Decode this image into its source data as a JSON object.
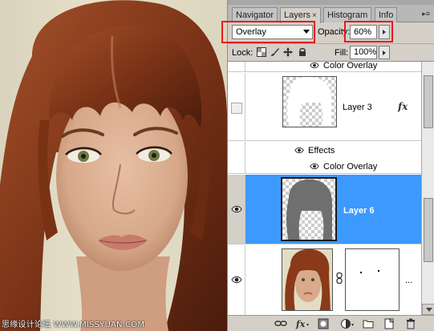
{
  "watermark": "思缘设计论坛  WWW.MISSYUAN.COM",
  "tabs": [
    {
      "label": "Navigator",
      "active": false
    },
    {
      "label": "Layers",
      "active": true
    },
    {
      "label": "Histogram",
      "active": false
    },
    {
      "label": "Info",
      "active": false
    }
  ],
  "tab_close_glyph": "×",
  "panel_menu_glyph": "▸≡",
  "blend_mode": "Overlay",
  "opacity": {
    "label": "Opacity:",
    "value": "60%"
  },
  "lock": {
    "label": "Lock:",
    "icons": [
      "transparent-pixels-icon",
      "brush-icon",
      "move-icon",
      "lock-icon"
    ]
  },
  "fill": {
    "label": "Fill:",
    "value": "100%"
  },
  "layers": {
    "partial_effect_top": "Color Overlay",
    "layer3": {
      "name": "Layer 3",
      "visible": false,
      "fx": "fx"
    },
    "layer3_effects_label": "Effects",
    "layer3_color_overlay": "Color Overlay",
    "layer6": {
      "name": "Layer 6",
      "selected": true,
      "visible": true
    },
    "photo_layer": {
      "visible": true,
      "more": "..."
    }
  },
  "bottom_icons": [
    "link-icon",
    "fx-icon",
    "mask-icon",
    "adjustment-icon",
    "folder-icon",
    "new-layer-icon",
    "trash-icon"
  ],
  "colors": {
    "selection": "#3c99fd",
    "highlight_box": "#e8191b"
  }
}
